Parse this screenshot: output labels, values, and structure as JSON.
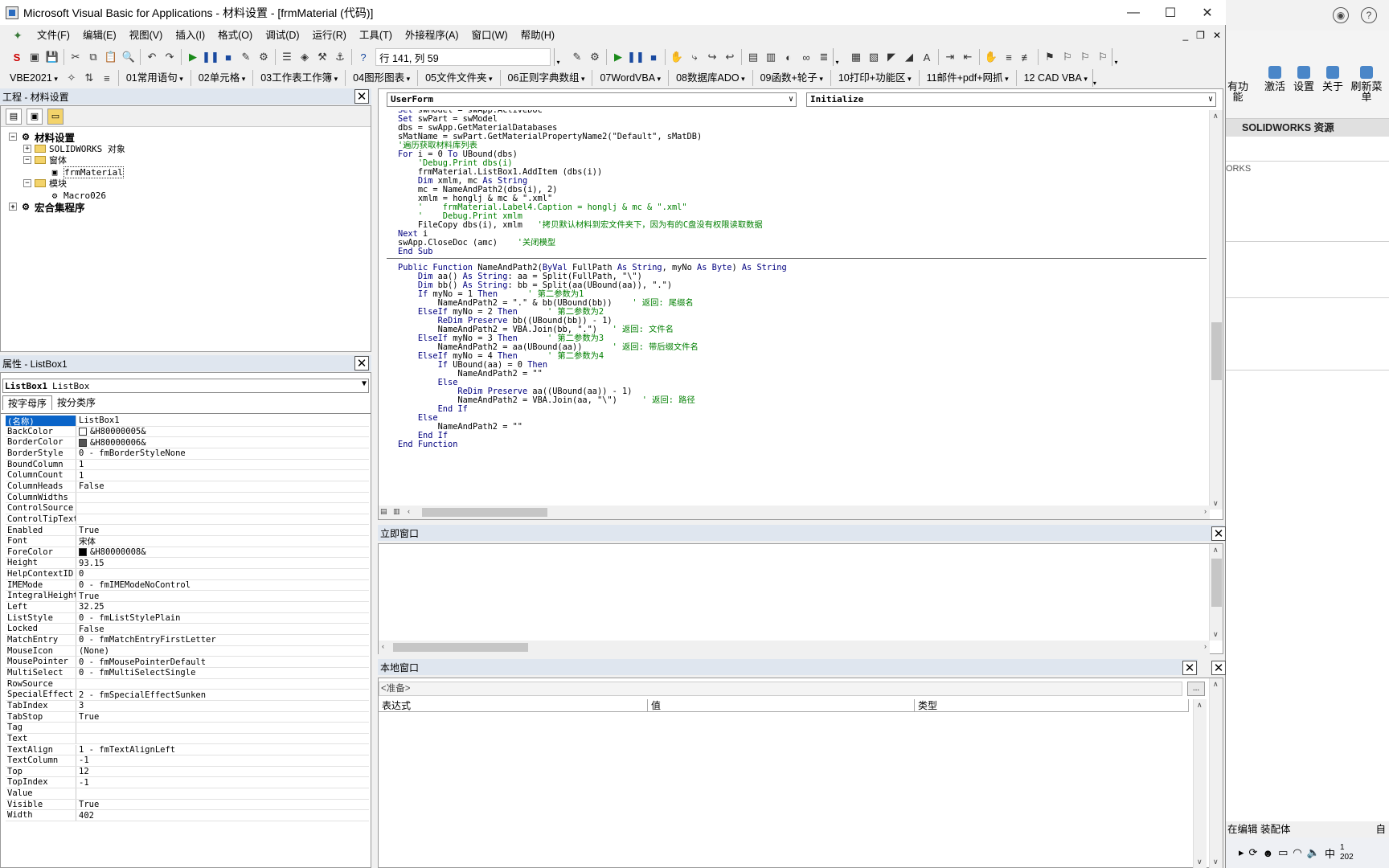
{
  "window": {
    "title": "Microsoft Visual Basic for Applications - 材料设置 - [frmMaterial (代码)]",
    "min": "—",
    "max": "☐",
    "close": "✕"
  },
  "menu": [
    "文件(F)",
    "编辑(E)",
    "视图(V)",
    "插入(I)",
    "格式(O)",
    "调试(D)",
    "运行(R)",
    "工具(T)",
    "外接程序(A)",
    "窗口(W)",
    "帮助(H)"
  ],
  "mdi": {
    "min": "_",
    "restore": "❐",
    "close": "✕"
  },
  "toolbar": {
    "position": "行 141, 列 59"
  },
  "toolbar2": [
    "VBE2021",
    "01常用语句",
    "02单元格",
    "03工作表工作簿",
    "04图形图表",
    "05文件文件夹",
    "06正则字典数组",
    "07WordVBA",
    "08数据库ADO",
    "09函数+轮子",
    "10打印+功能区",
    "11邮件+pdf+网抓",
    "12 CAD VBA"
  ],
  "project": {
    "title": "工程 - 材料设置",
    "nodes": [
      {
        "label": "材料设置",
        "level": 0
      },
      {
        "label": "SOLIDWORKS 对象",
        "level": 1
      },
      {
        "label": "窗体",
        "level": 1
      },
      {
        "label": "frmMaterial",
        "level": 2
      },
      {
        "label": "模块",
        "level": 1
      },
      {
        "label": "Macro026",
        "level": 2
      },
      {
        "label": "宏合集程序",
        "level": 0
      }
    ]
  },
  "properties": {
    "title": "属性 - ListBox1",
    "object_name": "ListBox1",
    "object_type": "ListBox",
    "tab_alpha": "按字母序",
    "tab_cat": "按分类序",
    "rows": [
      {
        "name": "(名称)",
        "value": "ListBox1"
      },
      {
        "name": "BackColor",
        "value": "&H80000005&",
        "swatch": "#ffffff"
      },
      {
        "name": "BorderColor",
        "value": "&H80000006&",
        "swatch": "#555555"
      },
      {
        "name": "BorderStyle",
        "value": "0 - fmBorderStyleNone"
      },
      {
        "name": "BoundColumn",
        "value": "1"
      },
      {
        "name": "ColumnCount",
        "value": "1"
      },
      {
        "name": "ColumnHeads",
        "value": "False"
      },
      {
        "name": "ColumnWidths",
        "value": ""
      },
      {
        "name": "ControlSource",
        "value": ""
      },
      {
        "name": "ControlTipText",
        "value": ""
      },
      {
        "name": "Enabled",
        "value": "True"
      },
      {
        "name": "Font",
        "value": "宋体"
      },
      {
        "name": "ForeColor",
        "value": "&H80000008&",
        "swatch": "#000000"
      },
      {
        "name": "Height",
        "value": "93.15"
      },
      {
        "name": "HelpContextID",
        "value": "0"
      },
      {
        "name": "IMEMode",
        "value": "0 - fmIMEModeNoControl"
      },
      {
        "name": "IntegralHeight",
        "value": "True"
      },
      {
        "name": "Left",
        "value": "32.25"
      },
      {
        "name": "ListStyle",
        "value": "0 - fmListStylePlain"
      },
      {
        "name": "Locked",
        "value": "False"
      },
      {
        "name": "MatchEntry",
        "value": "0 - fmMatchEntryFirstLetter"
      },
      {
        "name": "MouseIcon",
        "value": "(None)"
      },
      {
        "name": "MousePointer",
        "value": "0 - fmMousePointerDefault"
      },
      {
        "name": "MultiSelect",
        "value": "0 - fmMultiSelectSingle"
      },
      {
        "name": "RowSource",
        "value": ""
      },
      {
        "name": "SpecialEffect",
        "value": "2 - fmSpecialEffectSunken"
      },
      {
        "name": "TabIndex",
        "value": "3"
      },
      {
        "name": "TabStop",
        "value": "True"
      },
      {
        "name": "Tag",
        "value": ""
      },
      {
        "name": "Text",
        "value": ""
      },
      {
        "name": "TextAlign",
        "value": "1 - fmTextAlignLeft"
      },
      {
        "name": "TextColumn",
        "value": "-1"
      },
      {
        "name": "Top",
        "value": "12"
      },
      {
        "name": "TopIndex",
        "value": "-1"
      },
      {
        "name": "Value",
        "value": ""
      },
      {
        "name": "Visible",
        "value": "True"
      },
      {
        "name": "Width",
        "value": "402"
      }
    ]
  },
  "code": {
    "object_combo": "UserForm",
    "proc_combo": "Initialize",
    "lines1": [
      {
        "indent": 0,
        "code": "Set swModel = swApp.ActiveDoc",
        "comment": ""
      },
      {
        "indent": 0,
        "code": "Set swPart = swModel",
        "comment": ""
      },
      {
        "indent": 0,
        "code": "dbs = swApp.GetMaterialDatabases",
        "comment": ""
      },
      {
        "indent": 0,
        "code": "sMatName = swPart.GetMaterialPropertyName2(\"Default\", sMatDB)",
        "comment": ""
      },
      {
        "indent": 0,
        "code": "",
        "comment": "'遍历获取材料库列表"
      },
      {
        "indent": 0,
        "code": "For i = 0 To UBound(dbs)",
        "comment": ""
      },
      {
        "indent": 4,
        "code": "",
        "comment": "'Debug.Print dbs(i)"
      },
      {
        "indent": 4,
        "code": "frmMaterial.ListBox1.AddItem (dbs(i))",
        "comment": ""
      },
      {
        "indent": 4,
        "code": "Dim xmlm, mc As String",
        "comment": ""
      },
      {
        "indent": 4,
        "code": "mc = NameAndPath2(dbs(i), 2)",
        "comment": ""
      },
      {
        "indent": 4,
        "code": "xmlm = honglj & mc & \".xml\"",
        "comment": ""
      },
      {
        "indent": 4,
        "code": "",
        "comment": "'    frmMaterial.Label4.Caption = honglj & mc & \".xml\""
      },
      {
        "indent": 4,
        "code": "",
        "comment": "'    Debug.Print xmlm"
      },
      {
        "indent": 4,
        "code": "FileCopy dbs(i), xmlm   ",
        "comment": "'拷贝默认材料到宏文件夹下，因为有的C盘没有权限读取数据"
      },
      {
        "indent": 0,
        "code": "Next i",
        "comment": ""
      },
      {
        "indent": 0,
        "code": "swApp.CloseDoc (amc)    ",
        "comment": "'关闭模型"
      },
      {
        "indent": 0,
        "code": "End Sub",
        "comment": ""
      }
    ],
    "lines2": [
      {
        "indent": 0,
        "code": "Public Function NameAndPath2(ByVal FullPath As String, myNo As Byte) As String",
        "comment": ""
      },
      {
        "indent": 4,
        "code": "Dim aa() As String: aa = Split(FullPath, \"\\\")",
        "comment": ""
      },
      {
        "indent": 4,
        "code": "Dim bb() As String: bb = Split(aa(UBound(aa)), \".\")",
        "comment": ""
      },
      {
        "indent": 4,
        "code": "If myNo = 1 Then      ",
        "comment": "' 第二参数为1"
      },
      {
        "indent": 8,
        "code": "NameAndPath2 = \".\" & bb(UBound(bb))    ",
        "comment": "' 返回: 尾缀名"
      },
      {
        "indent": 4,
        "code": "ElseIf myNo = 2 Then      ",
        "comment": "' 第二参数为2"
      },
      {
        "indent": 8,
        "code": "ReDim Preserve bb((UBound(bb)) - 1)",
        "comment": ""
      },
      {
        "indent": 8,
        "code": "NameAndPath2 = VBA.Join(bb, \".\")   ",
        "comment": "' 返回: 文件名"
      },
      {
        "indent": 4,
        "code": "ElseIf myNo = 3 Then      ",
        "comment": "' 第二参数为3"
      },
      {
        "indent": 8,
        "code": "NameAndPath2 = aa(UBound(aa))      ",
        "comment": "' 返回: 带后缀文件名"
      },
      {
        "indent": 4,
        "code": "ElseIf myNo = 4 Then      ",
        "comment": "' 第二参数为4"
      },
      {
        "indent": 8,
        "code": "If UBound(aa) = 0 Then",
        "comment": ""
      },
      {
        "indent": 12,
        "code": "NameAndPath2 = \"\"",
        "comment": ""
      },
      {
        "indent": 8,
        "code": "Else",
        "comment": ""
      },
      {
        "indent": 12,
        "code": "ReDim Preserve aa((UBound(aa)) - 1)",
        "comment": ""
      },
      {
        "indent": 12,
        "code": "NameAndPath2 = VBA.Join(aa, \"\\\")     ",
        "comment": "' 返回: 路径"
      },
      {
        "indent": 8,
        "code": "End If",
        "comment": ""
      },
      {
        "indent": 4,
        "code": "Else",
        "comment": ""
      },
      {
        "indent": 8,
        "code": "NameAndPath2 = \"\"",
        "comment": ""
      },
      {
        "indent": 4,
        "code": "End If",
        "comment": ""
      },
      {
        "indent": 0,
        "code": "End Function",
        "comment": ""
      }
    ]
  },
  "immediate": {
    "title": "立即窗口"
  },
  "locals": {
    "title": "本地窗口",
    "ready": "<准备>",
    "ready_btn": "...",
    "col_expr": "表达式",
    "col_value": "值",
    "col_type": "类型"
  },
  "solidworks": {
    "ribbon": [
      "有功能",
      "激活",
      "设置",
      "关于",
      "刷新菜单"
    ],
    "resources": "SOLIDWORKS 资源",
    "works": "ORKS",
    "status": "在编辑 装配体",
    "status_right": "自",
    "ime": "中",
    "clock_top": "1",
    "clock_bottom": "202"
  }
}
